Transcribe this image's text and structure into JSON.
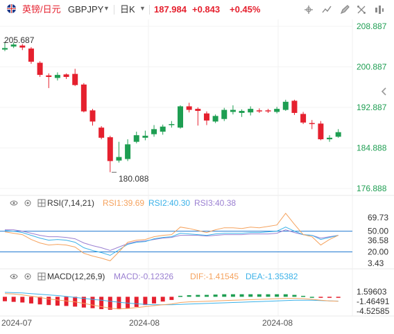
{
  "header": {
    "symbol_cn": "英镑/日元",
    "symbol_code": "GBPJPY",
    "period": "日K",
    "last_price": "187.984",
    "change": "+0.843",
    "change_pct": "+0.45%"
  },
  "toolbar_icons": [
    "crosshair-icon",
    "compare-icon",
    "draw-icon",
    "indicator-icon",
    "fullscreen-icon",
    "settings-icon"
  ],
  "colors": {
    "up": "#1e9e52",
    "down": "#e5202e",
    "price_axis_text": "#1e9e52",
    "rsi1": "#f5a25d",
    "rsi2": "#3ab1e8",
    "rsi3": "#9a7fd1",
    "dif": "#f5a25d",
    "dea": "#3ab1e8",
    "level_line": "#1f78d1"
  },
  "main_panel": {
    "price_labels": [
      "208.887",
      "200.887",
      "192.887",
      "184.888",
      "176.888"
    ],
    "high_annotation": "205.687",
    "low_annotation": "180.088"
  },
  "rsi_panel": {
    "name": "RSI(7,14,21)",
    "rsi1": "RSI1:39.69",
    "rsi2": "RSI2:40.30",
    "rsi3": "RSI3:40.38",
    "axis_labels": [
      "69.73",
      "50.00",
      "36.58",
      "20.00",
      "3.43"
    ]
  },
  "macd_panel": {
    "name": "MACD(12,26,9)",
    "macd": "MACD:-0.12326",
    "dif": "DIF:-1.41545",
    "dea": "DEA:-1.35382",
    "axis_labels": [
      "1.59603",
      "-1.46491",
      "-4.52585"
    ]
  },
  "date_labels": [
    "2024-07",
    "2024-08",
    "2024-08"
  ],
  "chart_data": {
    "type": "candlestick",
    "price_axis": [
      176.888,
      208.887
    ],
    "candles": [
      {
        "o": 204.3,
        "c": 204.6,
        "h": 205.7,
        "l": 204.0
      },
      {
        "o": 204.9,
        "c": 205.3,
        "h": 205.7,
        "l": 204.6
      },
      {
        "o": 205.1,
        "c": 204.7,
        "h": 205.4,
        "l": 204.2
      },
      {
        "o": 204.5,
        "c": 201.9,
        "h": 204.8,
        "l": 201.5
      },
      {
        "o": 201.7,
        "c": 199.3,
        "h": 202.0,
        "l": 198.9
      },
      {
        "o": 199.2,
        "c": 198.9,
        "h": 199.6,
        "l": 196.7
      },
      {
        "o": 198.7,
        "c": 199.3,
        "h": 199.8,
        "l": 198.2
      },
      {
        "o": 199.4,
        "c": 198.9,
        "h": 199.6,
        "l": 198.5
      },
      {
        "o": 199.5,
        "c": 197.3,
        "h": 200.5,
        "l": 197.1
      },
      {
        "o": 197.4,
        "c": 192.1,
        "h": 197.7,
        "l": 191.9
      },
      {
        "o": 192.3,
        "c": 190.1,
        "h": 192.6,
        "l": 189.3
      },
      {
        "o": 188.9,
        "c": 186.9,
        "h": 189.2,
        "l": 186.6
      },
      {
        "o": 187.0,
        "c": 182.3,
        "h": 187.3,
        "l": 180.1
      },
      {
        "o": 182.4,
        "c": 183.1,
        "h": 186.1,
        "l": 182.0
      },
      {
        "o": 182.7,
        "c": 185.6,
        "h": 186.6,
        "l": 182.3
      },
      {
        "o": 186.1,
        "c": 187.4,
        "h": 188.1,
        "l": 185.8
      },
      {
        "o": 186.9,
        "c": 187.3,
        "h": 188.3,
        "l": 186.4
      },
      {
        "o": 187.6,
        "c": 188.6,
        "h": 189.4,
        "l": 187.1
      },
      {
        "o": 188.1,
        "c": 189.1,
        "h": 189.5,
        "l": 187.5
      },
      {
        "o": 189.4,
        "c": 189.6,
        "h": 190.2,
        "l": 188.9
      },
      {
        "o": 188.9,
        "c": 193.1,
        "h": 193.3,
        "l": 188.7
      },
      {
        "o": 193.1,
        "c": 192.4,
        "h": 193.8,
        "l": 191.9
      },
      {
        "o": 192.6,
        "c": 192.2,
        "h": 192.9,
        "l": 189.3
      },
      {
        "o": 191.7,
        "c": 190.3,
        "h": 192.1,
        "l": 189.4
      },
      {
        "o": 190.1,
        "c": 191.2,
        "h": 191.5,
        "l": 189.8
      },
      {
        "o": 190.6,
        "c": 192.4,
        "h": 192.8,
        "l": 190.2
      },
      {
        "o": 192.0,
        "c": 192.4,
        "h": 193.3,
        "l": 191.5
      },
      {
        "o": 191.8,
        "c": 192.2,
        "h": 192.5,
        "l": 191.0
      },
      {
        "o": 191.9,
        "c": 192.6,
        "h": 193.1,
        "l": 191.3
      },
      {
        "o": 192.3,
        "c": 192.2,
        "h": 192.7,
        "l": 191.8
      },
      {
        "o": 192.3,
        "c": 192.2,
        "h": 192.6,
        "l": 191.8
      },
      {
        "o": 192.0,
        "c": 192.6,
        "h": 193.0,
        "l": 191.7
      },
      {
        "o": 192.4,
        "c": 194.0,
        "h": 194.4,
        "l": 192.2
      },
      {
        "o": 194.2,
        "c": 191.8,
        "h": 194.4,
        "l": 191.4
      },
      {
        "o": 191.6,
        "c": 189.9,
        "h": 192.0,
        "l": 189.6
      },
      {
        "o": 189.8,
        "c": 189.7,
        "h": 190.4,
        "l": 188.6
      },
      {
        "o": 189.7,
        "c": 186.6,
        "h": 190.2,
        "l": 186.4
      },
      {
        "o": 186.6,
        "c": 186.9,
        "h": 187.4,
        "l": 186.1
      },
      {
        "o": 187.1,
        "c": 188.0,
        "h": 188.6,
        "l": 186.9
      }
    ],
    "rsi_axis": [
      3.43,
      69.73
    ],
    "rsi_levels": [
      50,
      20
    ],
    "rsi1": [
      49,
      47,
      45,
      38,
      33,
      30,
      31,
      30,
      27,
      18,
      14,
      11,
      7,
      20,
      34,
      37,
      38,
      42,
      44,
      45,
      56,
      54,
      51,
      48,
      52,
      55,
      55,
      54,
      56,
      55,
      57,
      59,
      76,
      60,
      45,
      42,
      30,
      38,
      44
    ],
    "rsi2": [
      51,
      50,
      48,
      44,
      40,
      37,
      38,
      37,
      34,
      26,
      22,
      19,
      15,
      23,
      31,
      34,
      35,
      39,
      41,
      42,
      47,
      46,
      45,
      44,
      46,
      47,
      47,
      47,
      48,
      48,
      49,
      50,
      56,
      50,
      45,
      44,
      38,
      41,
      44
    ],
    "rsi3": [
      52,
      52,
      50,
      47,
      44,
      42,
      42,
      41,
      39,
      33,
      29,
      26,
      22,
      27,
      32,
      35,
      36,
      38,
      40,
      41,
      44,
      44,
      44,
      43,
      44,
      45,
      45,
      45,
      46,
      46,
      46,
      47,
      52,
      48,
      45,
      44,
      40,
      42,
      44
    ],
    "macd_axis": [
      -4.52585,
      1.59603
    ],
    "macd_hist": [
      -1.4,
      -1.6,
      -1.8,
      -2.1,
      -2.4,
      -2.6,
      -2.8,
      -2.9,
      -3.1,
      -3.4,
      -3.6,
      -3.9,
      -4.1,
      -3.9,
      -3.6,
      -3.2,
      -2.6,
      -2.1,
      -1.5,
      -1.0,
      0.3,
      0.5,
      0.6,
      0.6,
      0.7,
      0.8,
      0.8,
      0.8,
      0.8,
      0.8,
      0.8,
      0.8,
      0.8,
      0.6,
      0.3,
      0.0,
      -0.3,
      -0.3,
      -0.12
    ],
    "dif": [
      1.0,
      0.9,
      0.6,
      0.2,
      -0.2,
      -0.7,
      -1.0,
      -1.3,
      -1.6,
      -2.1,
      -2.6,
      -3.1,
      -3.6,
      -3.8,
      -3.7,
      -3.4,
      -3.1,
      -2.8,
      -2.5,
      -2.3,
      -1.8,
      -1.6,
      -1.5,
      -1.4,
      -1.3,
      -1.2,
      -1.1,
      -1.0,
      -0.9,
      -0.8,
      -0.7,
      -0.6,
      -0.5,
      -0.5,
      -0.6,
      -0.8,
      -1.1,
      -1.3,
      -1.4
    ],
    "dea": [
      1.4,
      1.3,
      1.2,
      1.0,
      0.8,
      0.6,
      0.4,
      0.1,
      -0.2,
      -0.5,
      -0.8,
      -1.1,
      -1.4,
      -1.7,
      -2.0,
      -2.2,
      -2.4,
      -2.5,
      -2.5,
      -2.5,
      -2.4,
      -2.3,
      -2.2,
      -2.1,
      -2.0,
      -1.9,
      -1.8,
      -1.7,
      -1.6,
      -1.5,
      -1.4,
      -1.3,
      -1.2,
      -1.1,
      -1.1,
      -1.1,
      -1.2,
      -1.3,
      -1.35
    ]
  }
}
